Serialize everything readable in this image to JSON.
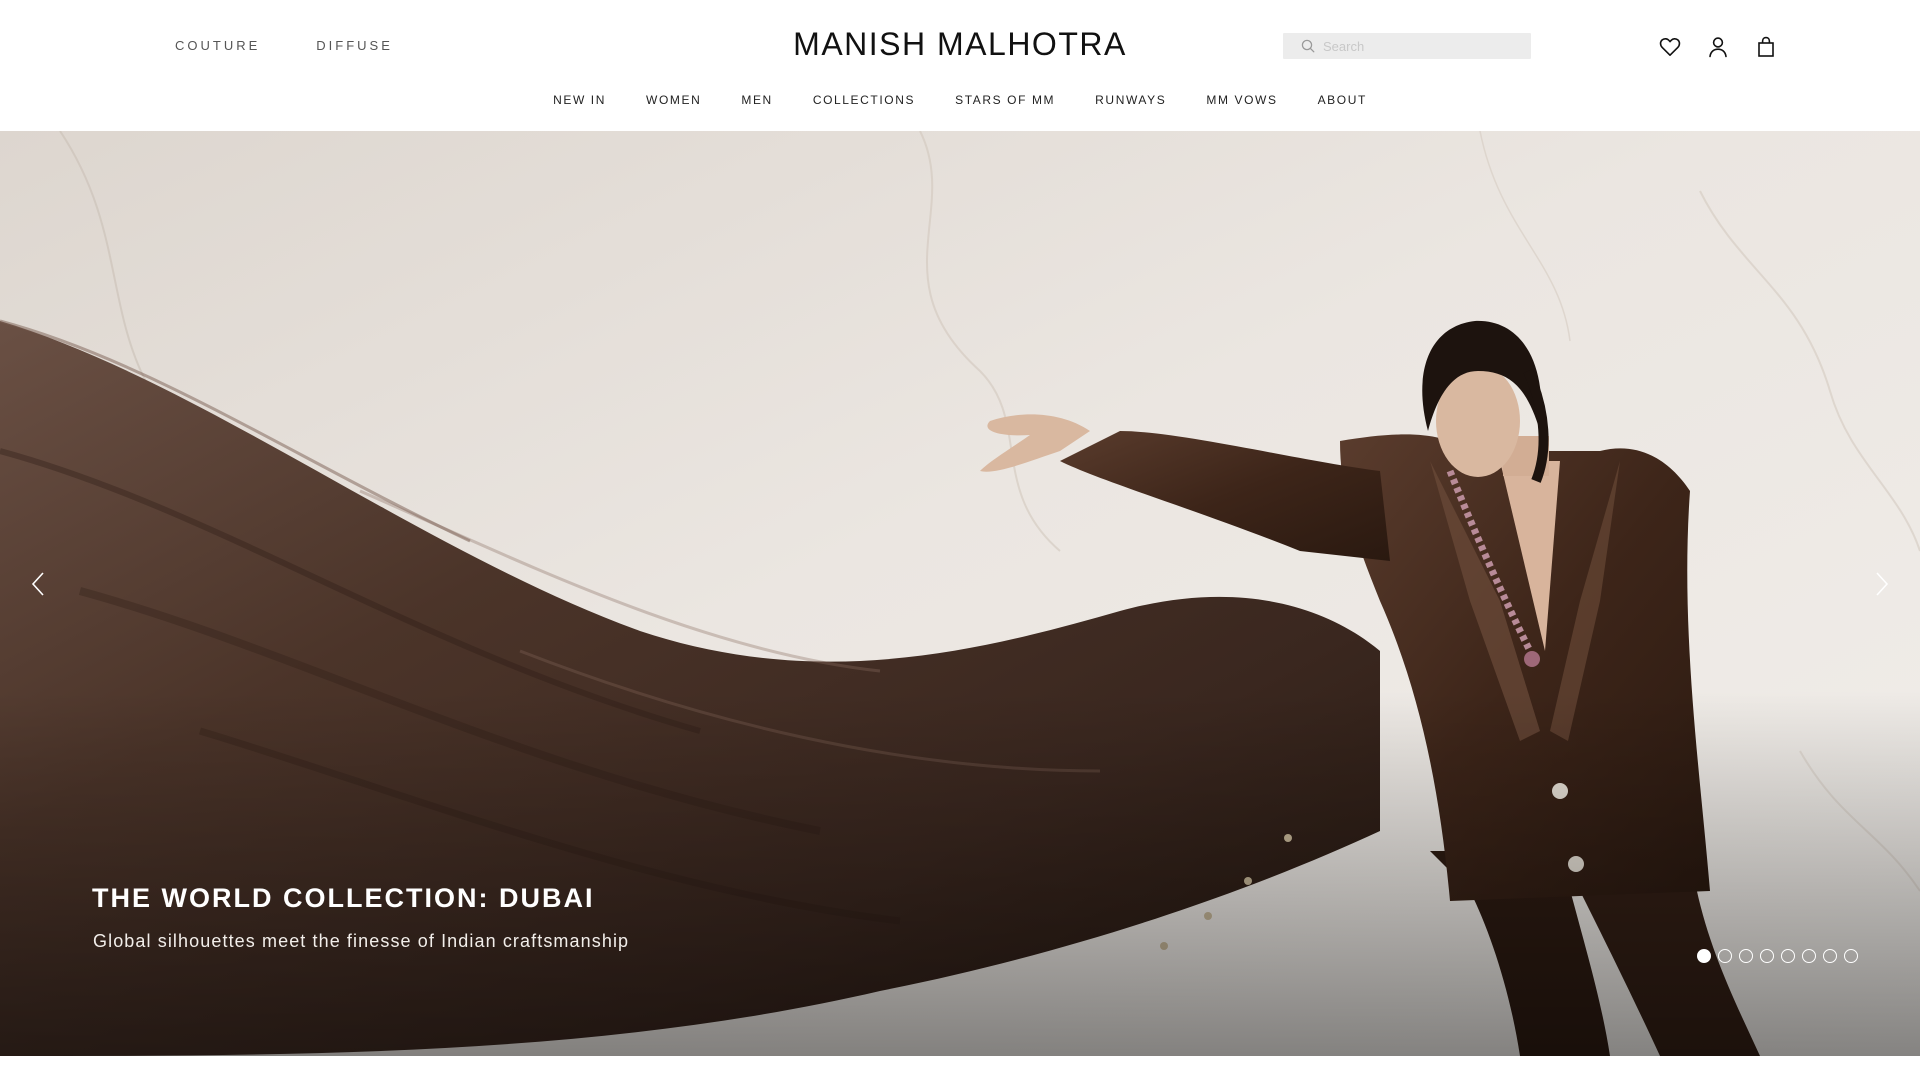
{
  "header": {
    "sub_brands": [
      "COUTURE",
      "DIFFUSE"
    ],
    "logo": "MANISH MALHOTRA",
    "search": {
      "placeholder": "Search",
      "value": ""
    },
    "icons": [
      "heart-icon",
      "user-icon",
      "bag-icon"
    ],
    "nav": [
      "NEW IN",
      "WOMEN",
      "MEN",
      "COLLECTIONS",
      "STARS OF MM",
      "RUNWAYS",
      "MM VOWS",
      "ABOUT"
    ]
  },
  "hero": {
    "title": "THE WORLD COLLECTION: DUBAI",
    "subtitle": "Global silhouettes meet the finesse of Indian craftsmanship",
    "slides_total": 8,
    "active_slide": 1,
    "prev_icon": "chevron-left-icon",
    "next_icon": "chevron-right-icon"
  },
  "colors": {
    "fabric": "#4a3428",
    "background_marble": "#e8e2dc",
    "text_on_hero": "#ffffff"
  }
}
